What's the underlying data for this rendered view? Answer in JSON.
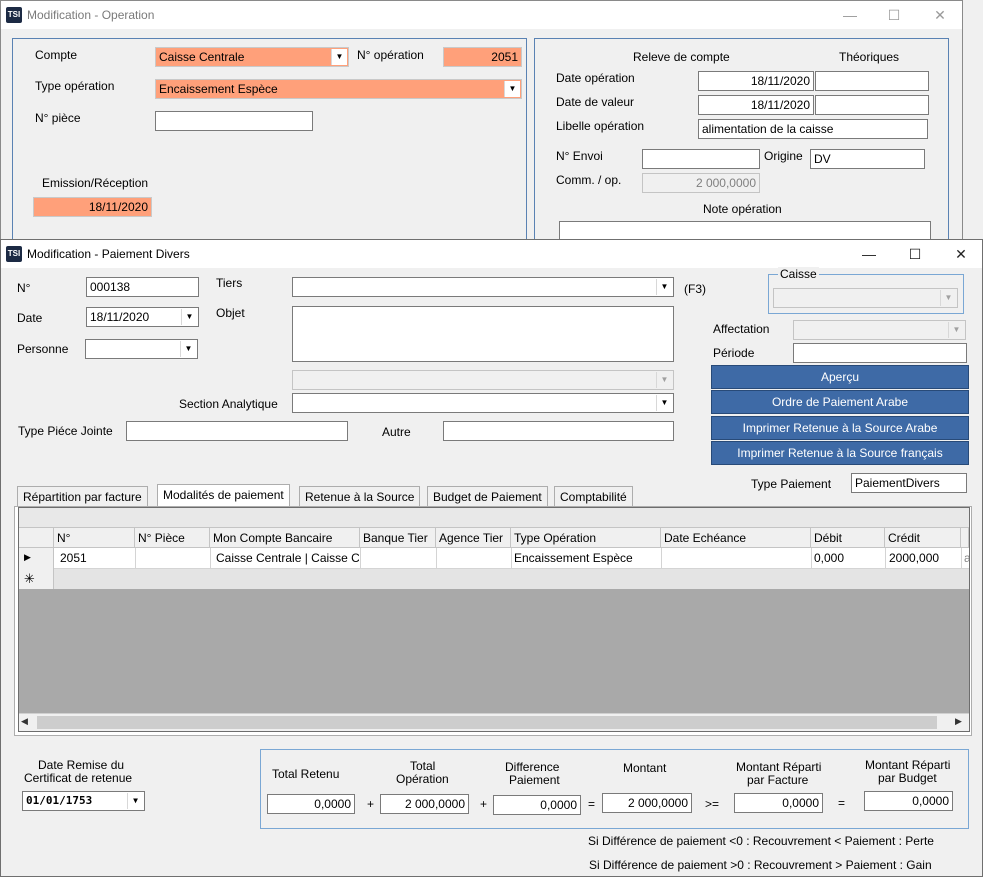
{
  "back_window": {
    "title": "Modification - Operation",
    "compte_label": "Compte",
    "compte_value": "Caisse Centrale",
    "num_operation_label": "N° opération",
    "num_operation_value": "2051",
    "type_operation_label": "Type opération",
    "type_operation_value": "Encaissement Espèce",
    "num_piece_label": "N° pièce",
    "emission_label": "Emission/Réception",
    "emission_value": "18/11/2020",
    "releve_label": "Releve de compte",
    "theoriques_label": "Théoriques",
    "date_operation_label": "Date opération",
    "date_operation_value": "18/11/2020",
    "date_valeur_label": "Date de valeur",
    "date_valeur_value": "18/11/2020",
    "libelle_label": "Libelle opération",
    "libelle_value": "alimentation de la caisse",
    "num_envoi_label": "N° Envoi",
    "origine_label": "Origine",
    "origine_value": "DV",
    "comm_label": "Comm. / op.",
    "comm_value": "2 000,0000",
    "note_label": "Note opération"
  },
  "front_window": {
    "title": "Modification - Paiement Divers",
    "num_label": "N°",
    "num_value": "000138",
    "date_label": "Date",
    "date_value": "18/11/2020",
    "personne_label": "Personne",
    "tiers_label": "Tiers",
    "f3_label": "(F3)",
    "objet_label": "Objet",
    "section_label": "Section Analytique",
    "type_piece_label": "Type Piéce Jointe",
    "autre_label": "Autre",
    "caisse_label": "Caisse",
    "affectation_label": "Affectation",
    "periode_label": "Période",
    "buttons": {
      "apercu": "Aperçu",
      "ordre_paiement_arabe": "Ordre de Paiement Arabe",
      "retenue_arabe": "Imprimer Retenue à la Source Arabe",
      "retenue_francais": "Imprimer Retenue à la Source français"
    },
    "type_paiement_label": "Type Paiement",
    "type_paiement_value": "PaiementDivers",
    "tabs": [
      "Répartition par facture",
      "Modalités de paiement",
      "Retenue à la Source",
      "Budget de Paiement",
      "Comptabilité"
    ],
    "active_tab": "Modalités de paiement",
    "grid": {
      "columns": [
        "N°",
        "N° Pièce",
        "Mon Compte Bancaire",
        "Banque Tier",
        "Agence Tier",
        "Type Opération",
        "Date Echéance",
        "Débit",
        "Crédit"
      ],
      "rows": [
        [
          "2051",
          "",
          "Caisse Centrale  | Caisse Central",
          "",
          "",
          "Encaissement Espèce",
          "",
          "0,000",
          "2000,000"
        ]
      ],
      "overflow_cell": "a"
    },
    "date_remise_label_1": "Date Remise du",
    "date_remise_label_2": "Certificat de retenue",
    "date_remise_value": "01/01/1753",
    "totals": {
      "total_retenu_label": "Total Retenu",
      "total_retenu_value": "0,0000",
      "total_operation_label_1": "Total",
      "total_operation_label_2": "Opération",
      "total_operation_value": "2 000,0000",
      "difference_label_1": "Difference",
      "difference_label_2": "Paiement",
      "difference_value": "0,0000",
      "montant_label": "Montant",
      "montant_value": "2 000,0000",
      "reparti_facture_label_1": "Montant Réparti",
      "reparti_facture_label_2": "par Facture",
      "reparti_facture_value": "0,0000",
      "reparti_budget_label_1": "Montant Réparti",
      "reparti_budget_label_2": "par Budget",
      "reparti_budget_value": "0,0000",
      "op_plus": "+",
      "op_equals": "=",
      "op_gte": ">="
    },
    "note_perte": "Si Différence de paiement <0 : Recouvrement < Paiement : Perte",
    "note_gain": "Si Différence de paiement >0 : Recouvrement > Paiement : Gain"
  },
  "window_controls": {
    "minimize": "—",
    "maximize": "☐",
    "close": "✕"
  }
}
